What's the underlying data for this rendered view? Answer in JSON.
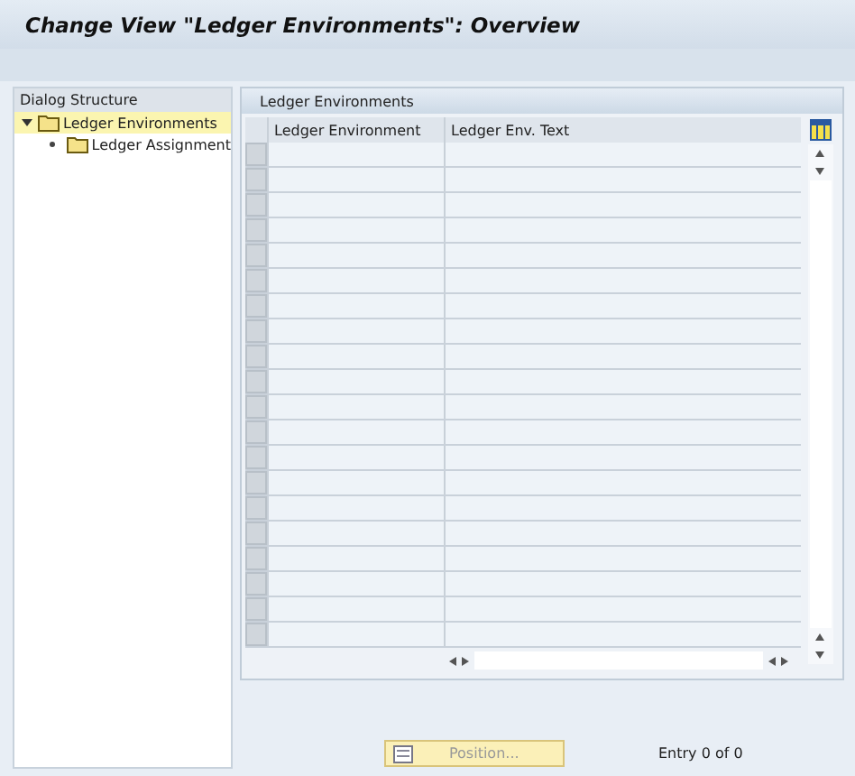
{
  "window": {
    "title": "Change View \"Ledger Environments\": Overview"
  },
  "dialog_structure": {
    "title": "Dialog Structure",
    "items": [
      {
        "label": "Ledger Environments",
        "expanded": true,
        "selected": true,
        "children": [
          {
            "label": "Ledger Assignment",
            "selected": false
          }
        ]
      }
    ]
  },
  "table": {
    "title": "Ledger Environments",
    "columns": [
      "Ledger Environment",
      "Ledger Env. Text"
    ]
  },
  "footer": {
    "position_button": {
      "label": "Position...",
      "disabled": true
    },
    "entry_count": "Entry 0 of 0"
  }
}
